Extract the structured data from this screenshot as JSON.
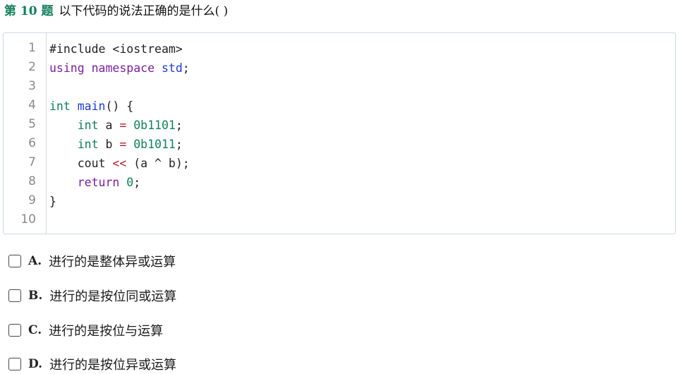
{
  "question": {
    "number_label": "第 10 题",
    "text": "以下代码的说法正确的是什么( )"
  },
  "code": {
    "line_numbers": [
      "1",
      "2",
      "3",
      "4",
      "5",
      "6",
      "7",
      "8",
      "9",
      "10"
    ],
    "line1": "#include <iostream>",
    "line2": {
      "using": "using",
      "namespace": "namespace",
      "std": "std",
      "semi": ";"
    },
    "line4": {
      "int": "int",
      "main": "main",
      "rest": "() {"
    },
    "line5": {
      "indent": "    ",
      "int": "int",
      "var": " a ",
      "eq": "=",
      "value": " 0b1101",
      "semi": ";"
    },
    "line6": {
      "indent": "    ",
      "int": "int",
      "var": " b ",
      "eq": "=",
      "value": " 0b1011",
      "semi": ";"
    },
    "line7": {
      "indent": "    ",
      "cout": "cout ",
      "op": "<<",
      "rest": " (a ^ b);"
    },
    "line8": {
      "indent": "    ",
      "ret": "return",
      "value": " 0",
      "semi": ";"
    },
    "line9": "}"
  },
  "options": [
    {
      "letter": "A.",
      "text": "进行的是整体异或运算"
    },
    {
      "letter": "B.",
      "text": "进行的是按位同或运算"
    },
    {
      "letter": "C.",
      "text": "进行的是按位与运算"
    },
    {
      "letter": "D.",
      "text": "进行的是按位异或运算"
    }
  ]
}
